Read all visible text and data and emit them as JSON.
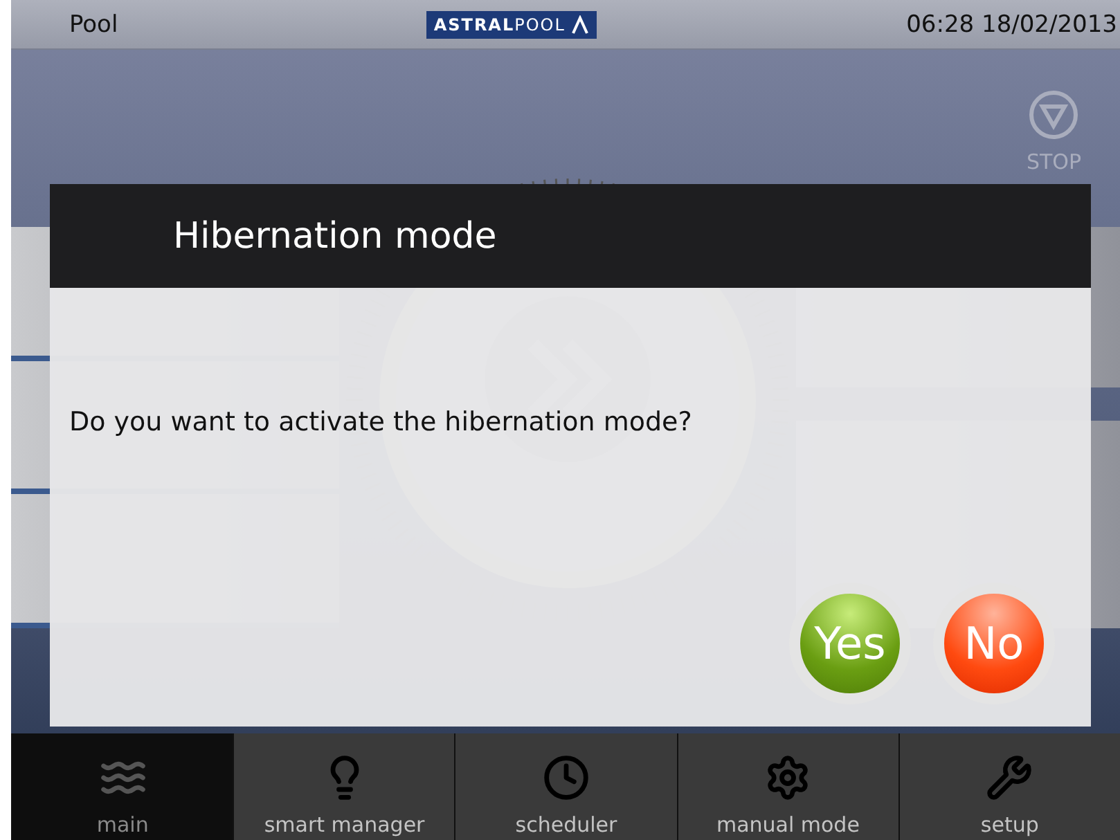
{
  "status_bar": {
    "title": "Pool",
    "logo": "**ASTRAL**POOL",
    "time": "06:28",
    "date": "18/02/2013"
  },
  "stop_button": {
    "label": "STOP"
  },
  "dialog": {
    "title": "Hibernation mode",
    "message": "Do you want to activate the hibernation mode?",
    "buttons": [
      {
        "label": "Yes",
        "kind": "confirm"
      },
      {
        "label": "No",
        "kind": "cancel"
      }
    ]
  },
  "nav": [
    {
      "label": "main",
      "selected": true
    },
    {
      "label": "smart manager",
      "selected": false
    },
    {
      "label": "scheduler",
      "selected": false
    },
    {
      "label": "manual mode",
      "selected": false
    },
    {
      "label": "setup",
      "selected": false
    }
  ]
}
